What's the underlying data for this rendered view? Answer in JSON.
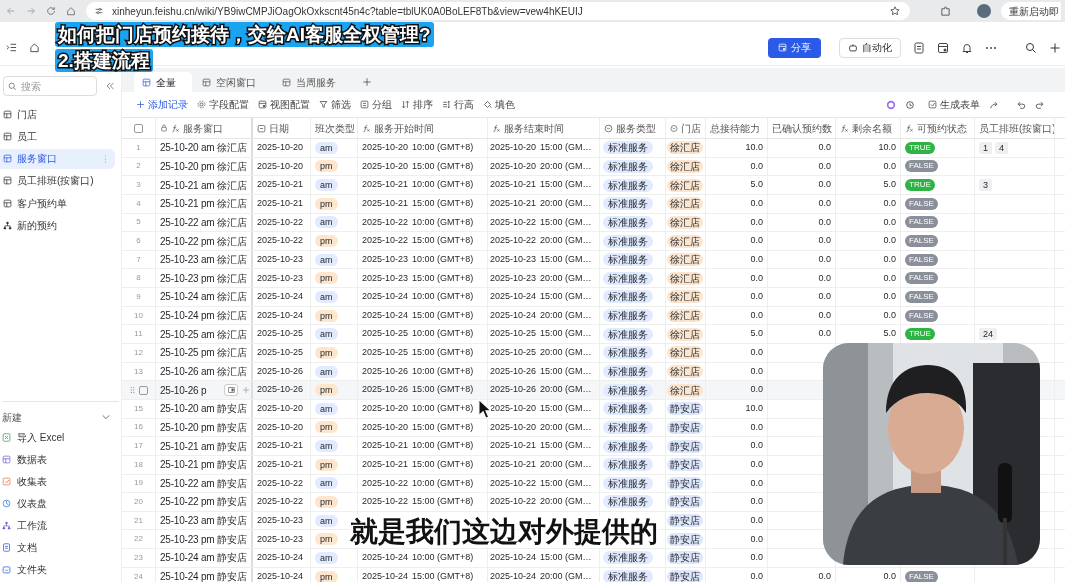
{
  "browser": {
    "url": "xinheyun.feishu.cn/wiki/YB9iwCMPJiOagOkOxkscnt45n4c?table=tblUK0A0BoLEF8Tb&view=vew4hKEUIJ",
    "relaunch": "重新启动即"
  },
  "caption": {
    "line1": "如何把门店预约接待，交给AI客服全权管理?",
    "line2": "2.搭建流程"
  },
  "subtitle": "就是我们这边对外提供的",
  "header": {
    "share": "分享",
    "automation": "自动化"
  },
  "sidebar": {
    "search_placeholder": "搜索",
    "items": [
      {
        "label": "门店",
        "kind": "table",
        "selected": false
      },
      {
        "label": "员工",
        "kind": "table",
        "selected": false
      },
      {
        "label": "服务窗口",
        "kind": "table",
        "selected": true
      },
      {
        "label": "员工排班(按窗口)",
        "kind": "table",
        "selected": false
      },
      {
        "label": "客户预约单",
        "kind": "table",
        "selected": false
      },
      {
        "label": "新的预约",
        "kind": "workflow",
        "selected": false
      }
    ],
    "new_section": {
      "title": "新建",
      "items": [
        {
          "label": "导入 Excel",
          "kind": "excel"
        },
        {
          "label": "数据表",
          "kind": "table"
        },
        {
          "label": "收集表",
          "kind": "form"
        },
        {
          "label": "仪表盘",
          "kind": "dashboard"
        },
        {
          "label": "工作流",
          "kind": "workflow"
        },
        {
          "label": "文档",
          "kind": "doc"
        },
        {
          "label": "文件夹",
          "kind": "folder"
        }
      ]
    }
  },
  "view_tabs": [
    {
      "label": "全量",
      "selected": true
    },
    {
      "label": "空闲窗口",
      "selected": false
    },
    {
      "label": "当周服务",
      "selected": false
    }
  ],
  "toolbar": {
    "add": "添加记录",
    "actions": [
      {
        "label": "字段配置",
        "kind": "gear"
      },
      {
        "label": "视图配置",
        "kind": "view"
      },
      {
        "label": "筛选",
        "kind": "filter"
      },
      {
        "label": "分组",
        "kind": "group"
      },
      {
        "label": "排序",
        "kind": "sort"
      },
      {
        "label": "行高",
        "kind": "height"
      },
      {
        "label": "填色",
        "kind": "fill"
      }
    ],
    "generate_form": "生成表单"
  },
  "table": {
    "select_all_checked": false,
    "columns": [
      {
        "label": "服务窗口",
        "kind": "lock-formula"
      },
      {
        "label": "日期",
        "kind": "date"
      },
      {
        "label": "班次类型",
        "kind": "text"
      },
      {
        "label": "服务开始时间",
        "kind": "formula"
      },
      {
        "label": "服务结束时间",
        "kind": "formula"
      },
      {
        "label": "服务类型",
        "kind": "select"
      },
      {
        "label": "门店",
        "kind": "select"
      },
      {
        "label": "总接待能力",
        "kind": "text"
      },
      {
        "label": "已确认预约数",
        "kind": "text"
      },
      {
        "label": "剩余名额",
        "kind": "formula"
      },
      {
        "label": "可预约状态",
        "kind": "formula"
      },
      {
        "label": "员工排班(按窗口)",
        "kind": "text"
      }
    ],
    "rows": [
      {
        "num": "1",
        "window": "25-10-20 am 徐汇店",
        "date": "2025-10-20",
        "shift": {
          "label": "am",
          "kind": "am"
        },
        "start_date": "2025-10-20",
        "start_time": "10:00 (GMT+8)",
        "end_date": "2025-10-20",
        "end_time": "15:00 (GM…",
        "service": "标准服务",
        "store": {
          "label": "徐汇店",
          "color": "#fbe5cf"
        },
        "capacity": "10.0",
        "confirmed": "0.0",
        "remaining": "10.0",
        "status": {
          "label": "TRUE",
          "available": true
        },
        "staff": [
          "1",
          "4"
        ]
      },
      {
        "num": "2",
        "window": "25-10-20 pm 徐汇店",
        "date": "2025-10-20",
        "shift": {
          "label": "pm",
          "kind": "pm"
        },
        "start_date": "2025-10-20",
        "start_time": "15:00 (GMT+8)",
        "end_date": "2025-10-20",
        "end_time": "20:00 (GM…",
        "service": "标准服务",
        "store": {
          "label": "徐汇店",
          "color": "#fbe5cf"
        },
        "capacity": "0.0",
        "confirmed": "0.0",
        "remaining": "0.0",
        "status": {
          "label": "FALSE",
          "available": false
        }
      },
      {
        "num": "3",
        "window": "25-10-21 am 徐汇店",
        "date": "2025-10-21",
        "shift": {
          "label": "am",
          "kind": "am"
        },
        "start_date": "2025-10-21",
        "start_time": "10:00 (GMT+8)",
        "end_date": "2025-10-21",
        "end_time": "15:00 (GM…",
        "service": "标准服务",
        "store": {
          "label": "徐汇店",
          "color": "#fbe5cf"
        },
        "capacity": "5.0",
        "confirmed": "0.0",
        "remaining": "5.0",
        "status": {
          "label": "TRUE",
          "available": true
        },
        "staff": [
          "3"
        ]
      },
      {
        "num": "4",
        "window": "25-10-21 pm 徐汇店",
        "date": "2025-10-21",
        "shift": {
          "label": "pm",
          "kind": "pm"
        },
        "start_date": "2025-10-21",
        "start_time": "15:00 (GMT+8)",
        "end_date": "2025-10-21",
        "end_time": "20:00 (GM…",
        "service": "标准服务",
        "store": {
          "label": "徐汇店",
          "color": "#fbe5cf"
        },
        "capacity": "0.0",
        "confirmed": "0.0",
        "remaining": "0.0",
        "status": {
          "label": "FALSE",
          "available": false
        }
      },
      {
        "num": "5",
        "window": "25-10-22 am 徐汇店",
        "date": "2025-10-22",
        "shift": {
          "label": "am",
          "kind": "am"
        },
        "start_date": "2025-10-22",
        "start_time": "10:00 (GMT+8)",
        "end_date": "2025-10-22",
        "end_time": "15:00 (GM…",
        "service": "标准服务",
        "store": {
          "label": "徐汇店",
          "color": "#fbe5cf"
        },
        "capacity": "0.0",
        "confirmed": "0.0",
        "remaining": "0.0",
        "status": {
          "label": "FALSE",
          "available": false
        }
      },
      {
        "num": "6",
        "window": "25-10-22 pm 徐汇店",
        "date": "2025-10-22",
        "shift": {
          "label": "pm",
          "kind": "pm"
        },
        "start_date": "2025-10-22",
        "start_time": "15:00 (GMT+8)",
        "end_date": "2025-10-22",
        "end_time": "20:00 (GM…",
        "service": "标准服务",
        "store": {
          "label": "徐汇店",
          "color": "#fbe5cf"
        },
        "capacity": "0.0",
        "confirmed": "0.0",
        "remaining": "0.0",
        "status": {
          "label": "FALSE",
          "available": false
        }
      },
      {
        "num": "7",
        "window": "25-10-23 am 徐汇店",
        "date": "2025-10-23",
        "shift": {
          "label": "am",
          "kind": "am"
        },
        "start_date": "2025-10-23",
        "start_time": "10:00 (GMT+8)",
        "end_date": "2025-10-23",
        "end_time": "15:00 (GM…",
        "service": "标准服务",
        "store": {
          "label": "徐汇店",
          "color": "#fbe5cf"
        },
        "capacity": "0.0",
        "confirmed": "0.0",
        "remaining": "0.0",
        "status": {
          "label": "FALSE",
          "available": false
        }
      },
      {
        "num": "8",
        "window": "25-10-23 pm 徐汇店",
        "date": "2025-10-23",
        "shift": {
          "label": "pm",
          "kind": "pm"
        },
        "start_date": "2025-10-23",
        "start_time": "15:00 (GMT+8)",
        "end_date": "2025-10-23",
        "end_time": "20:00 (GM…",
        "service": "标准服务",
        "store": {
          "label": "徐汇店",
          "color": "#fbe5cf"
        },
        "capacity": "0.0",
        "confirmed": "0.0",
        "remaining": "0.0",
        "status": {
          "label": "FALSE",
          "available": false
        }
      },
      {
        "num": "9",
        "window": "25-10-24 am 徐汇店",
        "date": "2025-10-24",
        "shift": {
          "label": "am",
          "kind": "am"
        },
        "start_date": "2025-10-24",
        "start_time": "10:00 (GMT+8)",
        "end_date": "2025-10-24",
        "end_time": "15:00 (GM…",
        "service": "标准服务",
        "store": {
          "label": "徐汇店",
          "color": "#fbe5cf"
        },
        "capacity": "0.0",
        "confirmed": "0.0",
        "remaining": "0.0",
        "status": {
          "label": "FALSE",
          "available": false
        }
      },
      {
        "num": "10",
        "window": "25-10-24 pm 徐汇店",
        "date": "2025-10-24",
        "shift": {
          "label": "pm",
          "kind": "pm"
        },
        "start_date": "2025-10-24",
        "start_time": "15:00 (GMT+8)",
        "end_date": "2025-10-24",
        "end_time": "20:00 (GM…",
        "service": "标准服务",
        "store": {
          "label": "徐汇店",
          "color": "#fbe5cf"
        },
        "capacity": "0.0",
        "confirmed": "0.0",
        "remaining": "0.0",
        "status": {
          "label": "FALSE",
          "available": false
        }
      },
      {
        "num": "11",
        "window": "25-10-25 am 徐汇店",
        "date": "2025-10-25",
        "shift": {
          "label": "am",
          "kind": "am"
        },
        "start_date": "2025-10-25",
        "start_time": "10:00 (GMT+8)",
        "end_date": "2025-10-25",
        "end_time": "15:00 (GM…",
        "service": "标准服务",
        "store": {
          "label": "徐汇店",
          "color": "#fbe5cf"
        },
        "capacity": "5.0",
        "confirmed": "0.0",
        "remaining": "5.0",
        "status": {
          "label": "TRUE",
          "available": true
        },
        "staff": [
          "24"
        ]
      },
      {
        "num": "12",
        "window": "25-10-25 pm 徐汇店",
        "date": "2025-10-25",
        "shift": {
          "label": "pm",
          "kind": "pm"
        },
        "start_date": "2025-10-25",
        "start_time": "15:00 (GMT+8)",
        "end_date": "2025-10-25",
        "end_time": "20:00 (GM…",
        "service": "标准服务",
        "store": {
          "label": "徐汇店",
          "color": "#fbe5cf"
        },
        "capacity": "0.0"
      },
      {
        "num": "13",
        "window": "25-10-26 am 徐汇店",
        "date": "2025-10-26",
        "shift": {
          "label": "am",
          "kind": "am"
        },
        "start_date": "2025-10-26",
        "start_time": "10:00 (GMT+8)",
        "end_date": "2025-10-26",
        "end_time": "15:00 (GM…",
        "service": "标准服务",
        "store": {
          "label": "徐汇店",
          "color": "#fbe5cf"
        },
        "capacity": "0.0"
      },
      {
        "hovered": true,
        "checked": false,
        "window": "25-10-26 p",
        "date": "2025-10-26",
        "shift": {
          "label": "pm",
          "kind": "pm"
        },
        "start_date": "2025-10-26",
        "start_time": "15:00 (GMT+8)",
        "end_date": "2025-10-26",
        "end_time": "20:00 (GM…",
        "service": "标准服务",
        "store": {
          "label": "徐汇店",
          "color": "#fbe5cf"
        },
        "capacity": "0.0"
      },
      {
        "num": "15",
        "window": "25-10-20 am 静安店",
        "date": "2025-10-20",
        "shift": {
          "label": "am",
          "kind": "am"
        },
        "start_date": "2025-10-20",
        "start_time": "10:00 (GMT+8)",
        "end_date": "2025-10-20",
        "end_time": "15:00 (GM…",
        "service": "标准服务",
        "store": {
          "label": "静安店",
          "color": "#dde6fb"
        },
        "capacity": "10.0"
      },
      {
        "num": "16",
        "window": "25-10-20 pm 静安店",
        "date": "2025-10-20",
        "shift": {
          "label": "pm",
          "kind": "pm"
        },
        "start_date": "2025-10-20",
        "start_time": "15:00 (GMT+8)",
        "end_date": "2025-10-20",
        "end_time": "20:00 (GM…",
        "service": "标准服务",
        "store": {
          "label": "静安店",
          "color": "#dde6fb"
        },
        "capacity": "0.0"
      },
      {
        "num": "17",
        "window": "25-10-21 am 静安店",
        "date": "2025-10-21",
        "shift": {
          "label": "am",
          "kind": "am"
        },
        "start_date": "2025-10-21",
        "start_time": "10:00 (GMT+8)",
        "end_date": "2025-10-21",
        "end_time": "15:00 (GM…",
        "service": "标准服务",
        "store": {
          "label": "静安店",
          "color": "#dde6fb"
        },
        "capacity": "0.0"
      },
      {
        "num": "18",
        "window": "25-10-21 pm 静安店",
        "date": "2025-10-21",
        "shift": {
          "label": "pm",
          "kind": "pm"
        },
        "start_date": "2025-10-21",
        "start_time": "15:00 (GMT+8)",
        "end_date": "2025-10-21",
        "end_time": "20:00 (GM…",
        "service": "标准服务",
        "store": {
          "label": "静安店",
          "color": "#dde6fb"
        },
        "capacity": "0.0"
      },
      {
        "num": "19",
        "window": "25-10-22 am 静安店",
        "date": "2025-10-22",
        "shift": {
          "label": "am",
          "kind": "am"
        },
        "start_date": "2025-10-22",
        "start_time": "10:00 (GMT+8)",
        "end_date": "2025-10-22",
        "end_time": "15:00 (GM…",
        "service": "标准服务",
        "store": {
          "label": "静安店",
          "color": "#dde6fb"
        },
        "capacity": "0.0"
      },
      {
        "num": "20",
        "window": "25-10-22 pm 静安店",
        "date": "2025-10-22",
        "shift": {
          "label": "pm",
          "kind": "pm"
        },
        "start_date": "2025-10-22",
        "start_time": "15:00 (GMT+8)",
        "end_date": "2025-10-22",
        "end_time": "20:00 (GM…",
        "service": "标准服务",
        "store": {
          "label": "静安店",
          "color": "#dde6fb"
        },
        "capacity": "0.0"
      },
      {
        "num": "21",
        "window": "25-10-23 am 静安店",
        "date": "2025-10-23",
        "shift": {
          "label": "am",
          "kind": "am"
        },
        "store": {
          "label": "静安店",
          "color": "#dde6fb"
        },
        "capacity": "0.0"
      },
      {
        "num": "22",
        "window": "25-10-23 pm 静安店",
        "date": "2025-10-23",
        "shift": {
          "label": "pm",
          "kind": "pm"
        },
        "store": {
          "label": "静安店",
          "color": "#dde6fb"
        },
        "capacity": "0.0"
      },
      {
        "num": "23",
        "window": "25-10-24 am 静安店",
        "date": "2025-10-24",
        "shift": {
          "label": "am",
          "kind": "am"
        },
        "start_date": "2025-10-24",
        "start_time": "10:00 (GMT+8)",
        "end_date": "2025-10-24",
        "end_time": "15:00 (GM…",
        "service": "标准服务",
        "store": {
          "label": "静安店",
          "color": "#dde6fb"
        },
        "capacity": "0.0"
      },
      {
        "num": "24",
        "window": "25-10-24 pm 静安店",
        "date": "2025-10-24",
        "shift": {
          "label": "pm",
          "kind": "pm"
        },
        "start_date": "2025-10-24",
        "start_time": "15:00 (GMT+8)",
        "end_date": "2025-10-24",
        "end_time": "20:00 (GM…",
        "service": "标准服务",
        "store": {
          "label": "静安店",
          "color": "#dde6fb"
        },
        "capacity": "0.0",
        "confirmed": "0.0",
        "remaining": "0.0",
        "status": {
          "label": "FALSE",
          "available": false
        }
      }
    ]
  }
}
